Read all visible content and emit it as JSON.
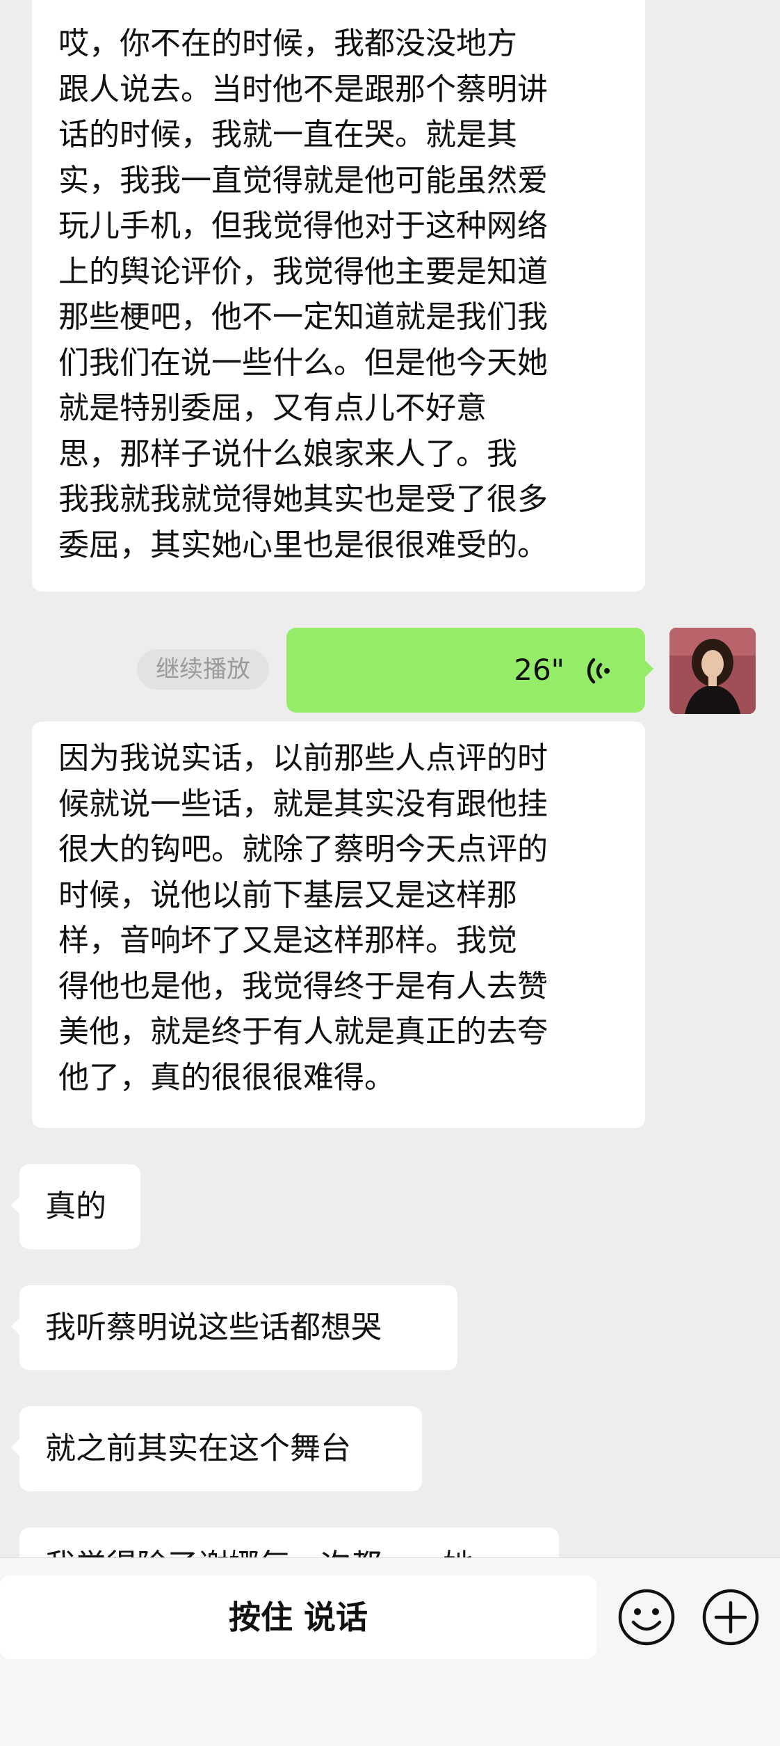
{
  "messages": {
    "m1_lines": [
      "哎，你不在的时候，我都没没地方",
      "跟人说去。当时他不是跟那个蔡明讲",
      "话的时候，我就一直在哭。就是其",
      "实，我我一直觉得就是他可能虽然爱",
      "玩儿手机，但我觉得他对于这种网络",
      "上的舆论评价，我觉得他主要是知道",
      "那些梗吧，他不一定知道就是我们我",
      "们我们在说一些什么。但是他今天她",
      "就是特别委屈，又有点儿不好意",
      "思，那样子说什么娘家来人了。我",
      "我我就我就觉得她其实也是受了很多",
      "委屈，其实她心里也是很很难受的。"
    ],
    "continue_label": "继续播放",
    "voice_duration": "26\"",
    "m2_lines": [
      "因为我说实话，以前那些人点评的时",
      "候就说一些话，就是其实没有跟他挂",
      "很大的钩吧。就除了蔡明今天点评的",
      "时候，说他以前下基层又是这样那",
      "样，音响坏了又是这样那样。我觉",
      "得他也是他，我觉得终于是有人去赞",
      "美他，就是终于有人就是真正的去夸",
      "他了，真的很很很难得。"
    ],
    "m3": "真的",
    "m4": "我听蔡明说这些话都想哭",
    "m5": "就之前其实在这个舞台",
    "m6": "我觉得除了谢娜每一次都……她"
  },
  "input_bar": {
    "hold_to_talk": "按住 说话",
    "emoji_icon": "emoji-icon",
    "plus_icon": "plus-icon"
  },
  "colors": {
    "background": "#ededed",
    "voice_bubble": "#95ec69",
    "bubble": "#ffffff"
  }
}
